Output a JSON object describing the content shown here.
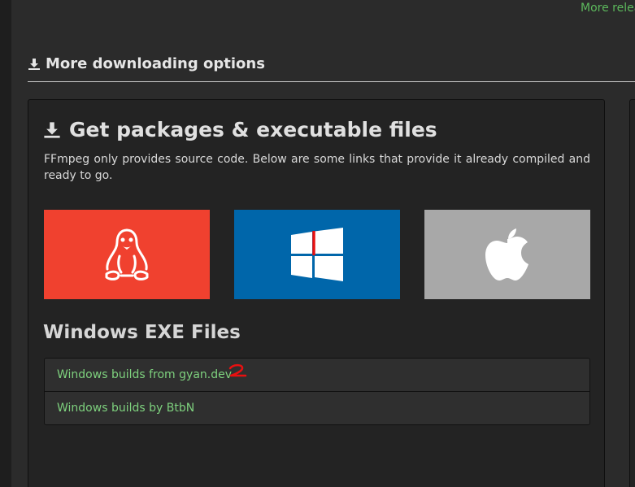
{
  "top_link": "More relea",
  "section": {
    "title": "More downloading options",
    "icon": "download-icon"
  },
  "panel": {
    "title": "Get packages & executable files",
    "title_icon": "download-icon",
    "description": "FFmpeg only provides source code. Below are some links that provide it already compiled and ready to go.",
    "tiles": [
      {
        "name": "linux",
        "icon": "linux-tux-icon",
        "color": "#f0412f"
      },
      {
        "name": "windows",
        "icon": "windows-logo-icon",
        "color": "#0066aa"
      },
      {
        "name": "mac",
        "icon": "apple-logo-icon",
        "color": "#a8a8a8"
      }
    ]
  },
  "windows_section": {
    "title": "Windows EXE Files",
    "links": [
      {
        "label": "Windows builds from gyan.dev"
      },
      {
        "label": "Windows builds by BtbN"
      }
    ]
  },
  "annotation": {
    "text": "2",
    "color": "#e81010"
  },
  "colors": {
    "accent_link": "#7ed17e",
    "background": "#2b2b2b",
    "panel": "#232323"
  }
}
